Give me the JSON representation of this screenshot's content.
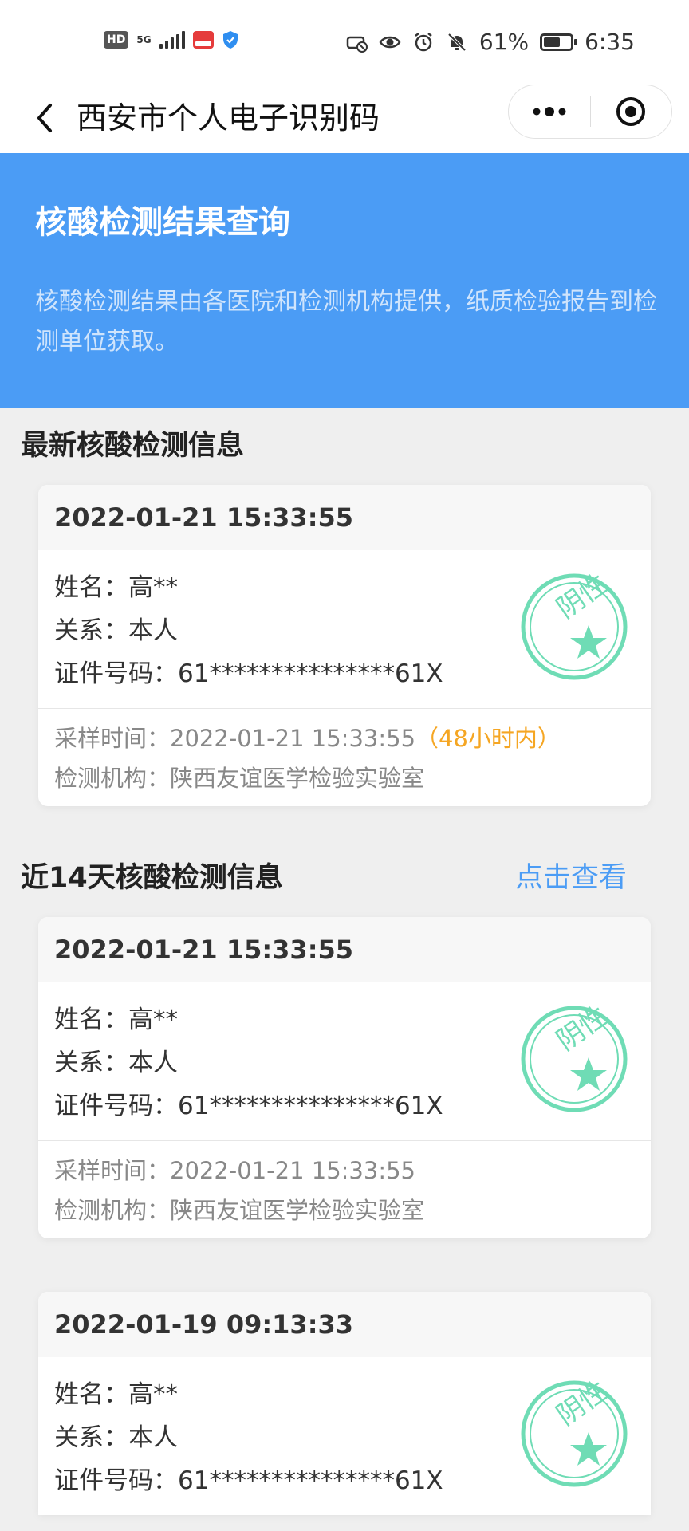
{
  "status_bar": {
    "hd": "HD",
    "network": "5G",
    "battery_percent": "61%",
    "battery_level": 0.61,
    "time": "6:35"
  },
  "nav": {
    "title": "西安市个人电子识别码"
  },
  "banner": {
    "title": "核酸检测结果查询",
    "description": "核酸检测结果由各医院和检测机构提供，纸质检验报告到检测单位获取。"
  },
  "latest": {
    "section_title": "最新核酸检测信息",
    "record": {
      "datetime": "2022-01-21 15:33:55",
      "name": "姓名：高**",
      "relation": "关系：本人",
      "id_number": "证件号码：61***************61X",
      "sampling_label": "采样时间：",
      "sampling_time": "2022-01-21 15:33:55",
      "sampling_note": "（48小时内）",
      "institution": "检测机构：陕西友谊医学检验实验室",
      "result": "阴性"
    }
  },
  "recent": {
    "section_title": "近14天核酸检测信息",
    "view_link": "点击查看",
    "records": [
      {
        "datetime": "2022-01-21 15:33:55",
        "name": "姓名：高**",
        "relation": "关系：本人",
        "id_number": "证件号码：61***************61X",
        "sampling": "采样时间：2022-01-21 15:33:55",
        "institution": "检测机构：陕西友谊医学检验实验室",
        "result": "阴性"
      },
      {
        "datetime": "2022-01-19 09:13:33",
        "name": "姓名：高**",
        "relation": "关系：本人",
        "id_number": "证件号码：61***************61X",
        "result": "阴性"
      }
    ]
  },
  "colors": {
    "accent_blue": "#4b9cf5",
    "stamp_green": "#6fdcb5",
    "highlight_orange": "#f5a623"
  }
}
